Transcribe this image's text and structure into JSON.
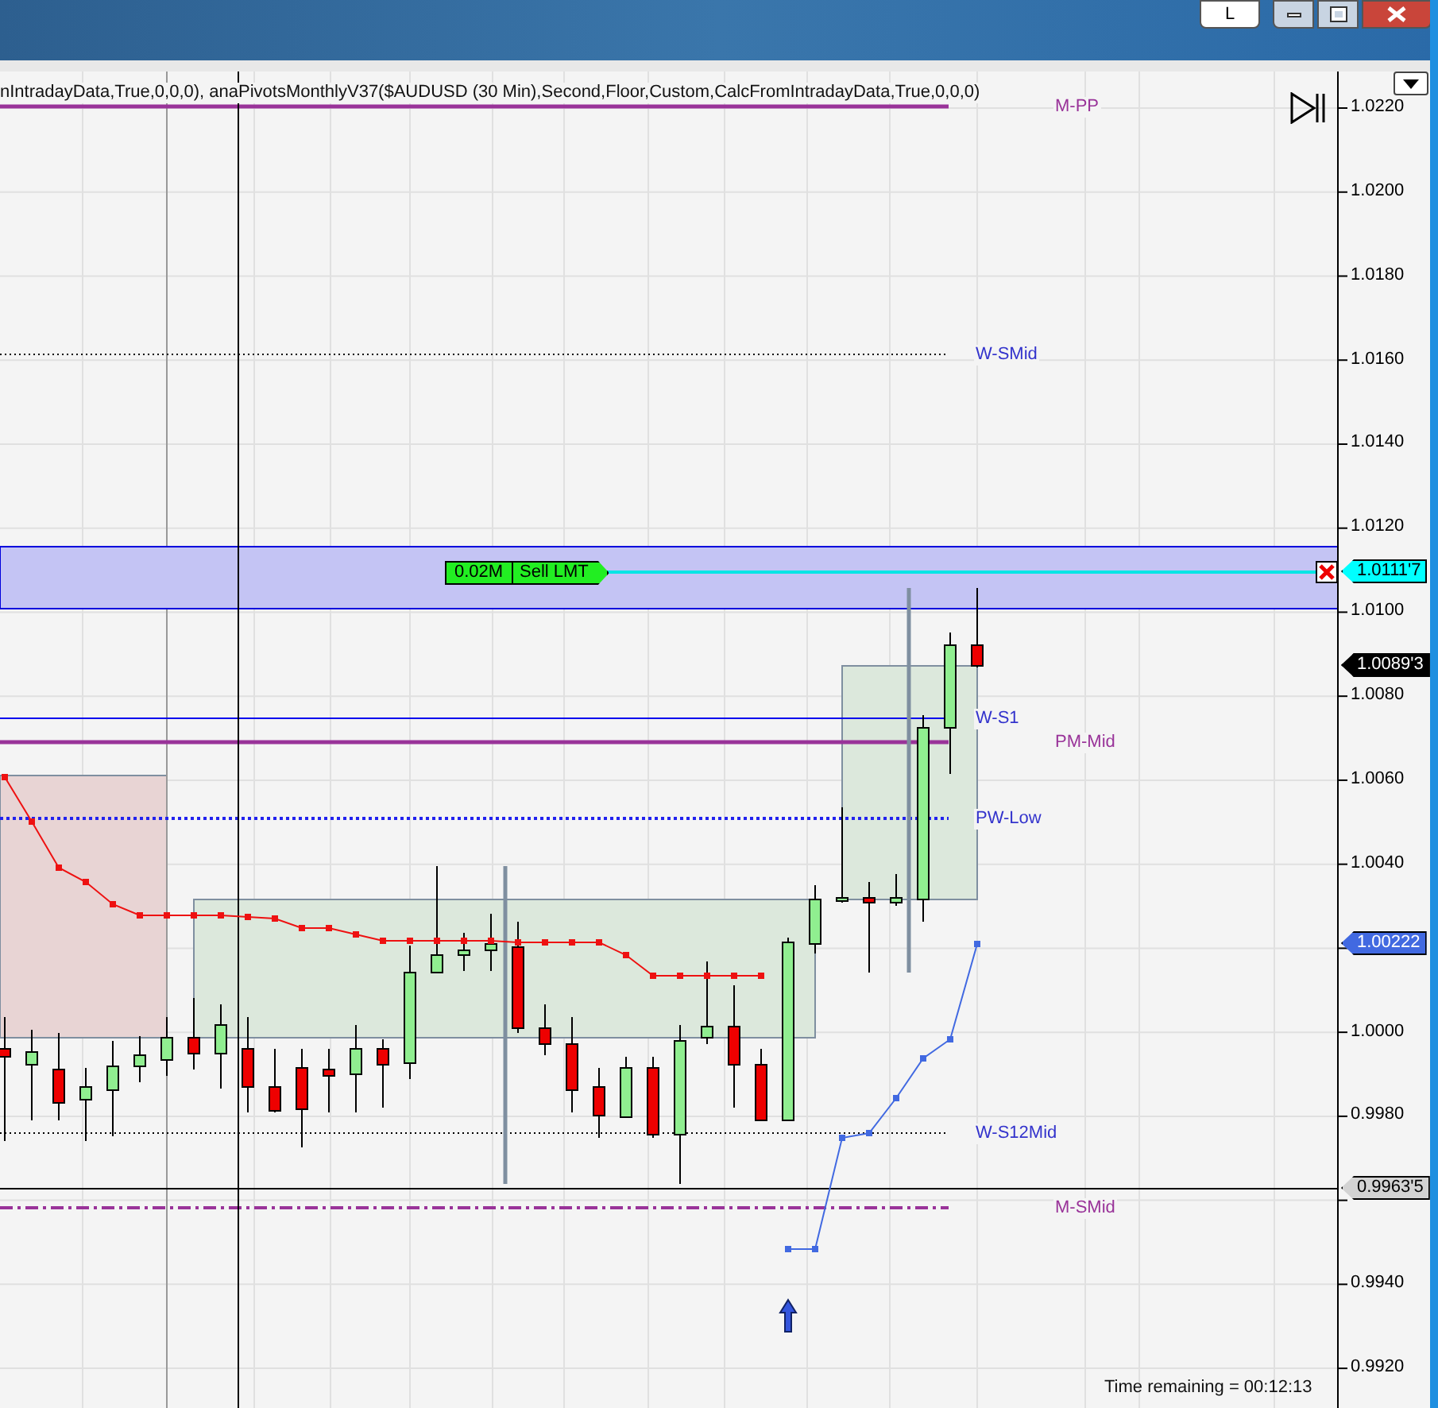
{
  "window": {
    "layout_button": "L"
  },
  "indicator_text": "nIntradayData,True,0,0,0), anaPivotsMonthlyV37($AUDUSD (30 Min),Second,Floor,Custom,CalcFromIntradayData,True,0,0,0)",
  "level_labels": [
    {
      "text": "M-PP",
      "color": "#993399"
    },
    {
      "text": "W-SMid",
      "color": "#3333cc"
    },
    {
      "text": "W-S1",
      "color": "#3333cc"
    },
    {
      "text": "PM-Mid",
      "color": "#993399"
    },
    {
      "text": "PW-Low",
      "color": "#3333cc"
    },
    {
      "text": "W-S12Mid",
      "color": "#3333cc"
    },
    {
      "text": "M-SMid",
      "color": "#993399"
    }
  ],
  "y_axis": {
    "ticks": [
      "1.0220",
      "1.0200",
      "1.0180",
      "1.0160",
      "1.0140",
      "1.0120",
      "1.0100",
      "1.0080",
      "1.0060",
      "1.0040",
      "1.0000",
      "0.9980",
      "0.9940",
      "0.9920"
    ]
  },
  "price_tags": [
    {
      "text": "1.0111'7",
      "color": "#00ffff"
    },
    {
      "text": "1.0089'3",
      "color": "#000000"
    },
    {
      "text": "1.00222",
      "color": "#4169e1"
    },
    {
      "text": "0.9963'5",
      "color": "#d3d3d3"
    }
  ],
  "order": {
    "quantity": "0.02M",
    "type": "Sell LMT"
  },
  "time_remaining": "Time remaining = 00:12:13"
}
